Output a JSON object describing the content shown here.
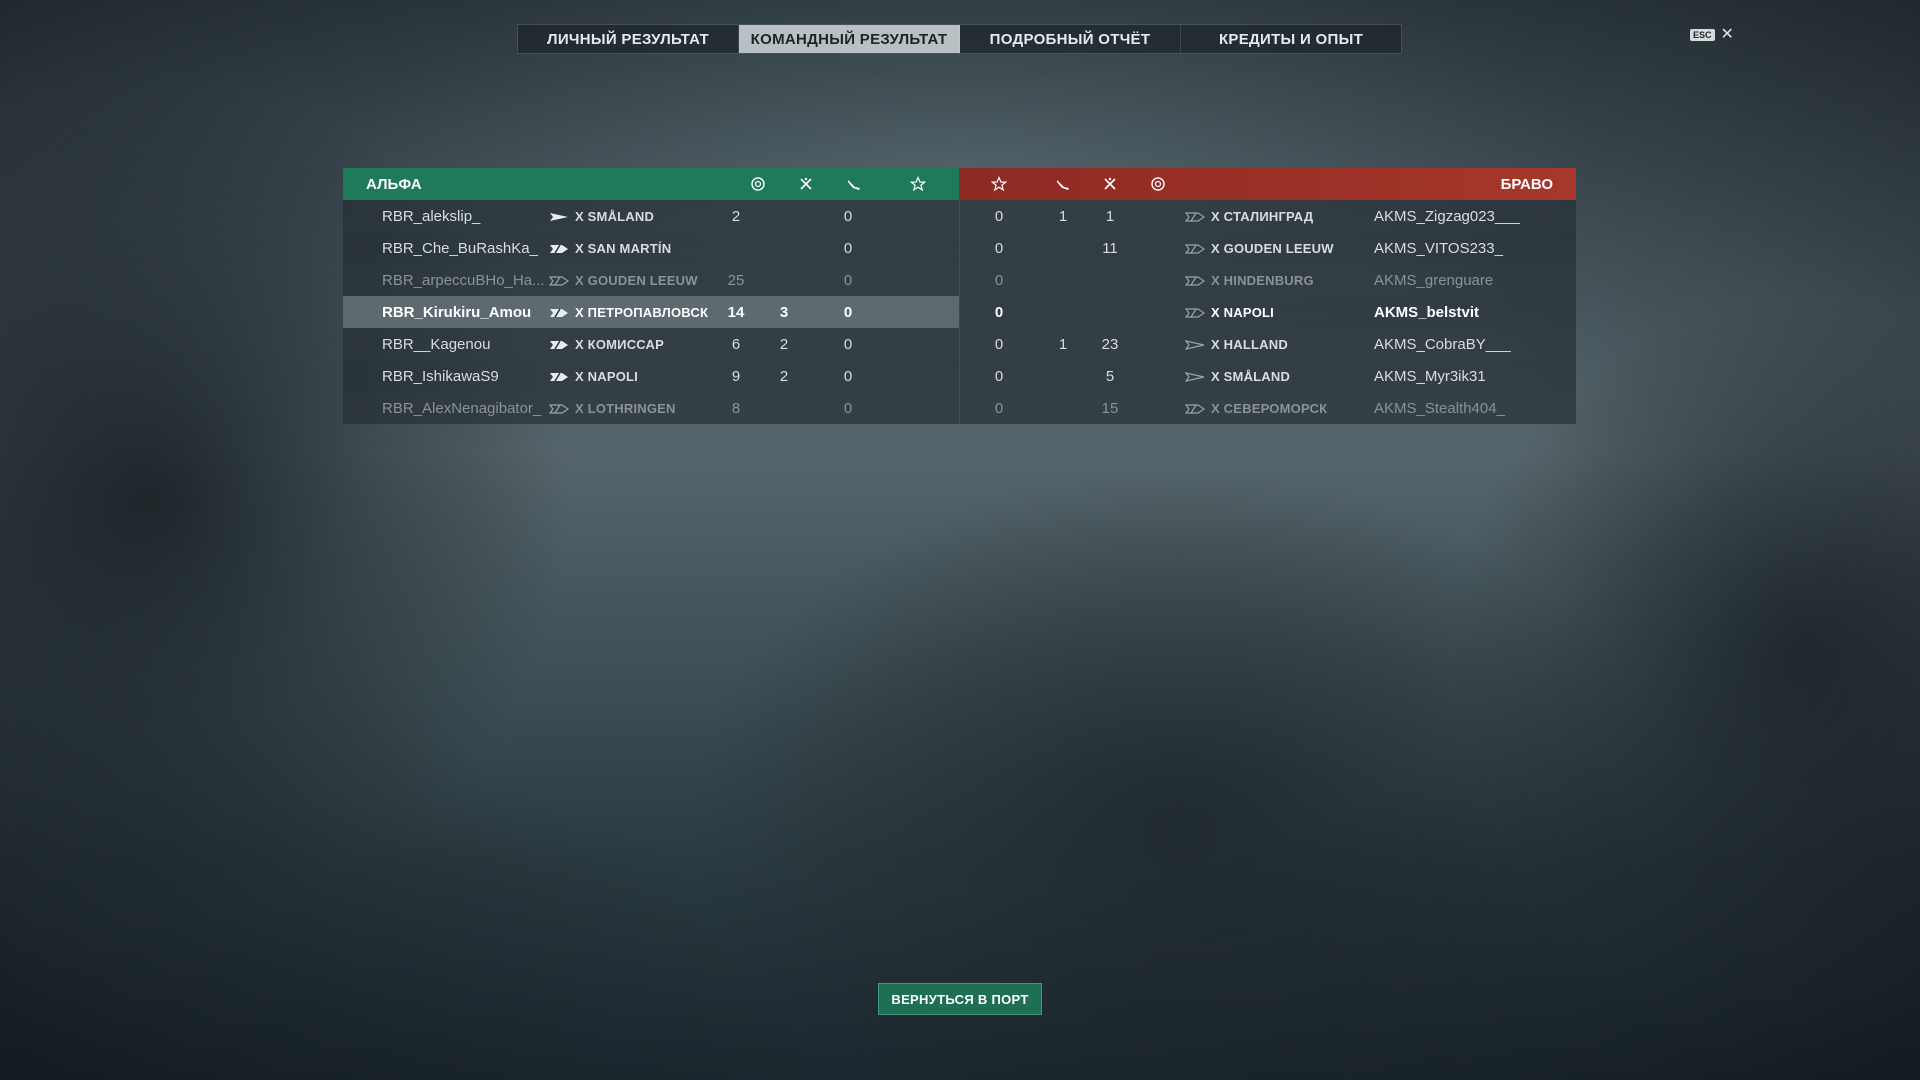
{
  "tabs": [
    {
      "label": "ЛИЧНЫЙ РЕЗУЛЬТАТ",
      "active": false
    },
    {
      "label": "КОМАНДНЫЙ РЕЗУЛЬТАТ",
      "active": true
    },
    {
      "label": "ПОДРОБНЫЙ ОТЧЁТ",
      "active": false
    },
    {
      "label": "КРЕДИТЫ И ОПЫТ",
      "active": false
    }
  ],
  "close": {
    "key_label": "ESC",
    "icon": "close-icon"
  },
  "teams": {
    "alpha": {
      "name": "АЛЬФА",
      "color": "#1e7a59"
    },
    "bravo": {
      "name": "БРАВО",
      "color": "#a8372b"
    }
  },
  "columns": {
    "icons": [
      "base-capture-icon",
      "frags-icon",
      "planes-icon",
      "star-icon"
    ]
  },
  "rows": [
    {
      "state": "alive",
      "left": {
        "player": "RBR_alekslip_",
        "ship": "X SMÅLAND",
        "ship_class": "destroyer",
        "base": "",
        "frags": "2",
        "planes": "",
        "star": "0"
      },
      "right": {
        "player": "AKMS_Zigzag023___",
        "ship": "X СТАЛИНГРАД",
        "ship_class": "cruiser-dead",
        "star": "0",
        "planes": "1",
        "frags": "1",
        "base": ""
      }
    },
    {
      "state": "alive",
      "left": {
        "player": "RBR_Che_BuRashKa_",
        "ship": "X SAN MARTÍN",
        "ship_class": "cruiser",
        "base": "",
        "frags": "",
        "planes": "",
        "star": "0"
      },
      "right": {
        "player": "AKMS_VITOS233_",
        "ship": "X GOUDEN LEEUW",
        "ship_class": "cruiser-dead",
        "star": "0",
        "planes": "",
        "frags": "11",
        "base": ""
      }
    },
    {
      "state": "dead",
      "left": {
        "player": "RBR_arpeccuBHo_Ha...",
        "ship": "X GOUDEN LEEUW",
        "ship_class": "cruiser-dead",
        "base": "",
        "frags": "25",
        "planes": "",
        "star": "0"
      },
      "right": {
        "player": "AKMS_grenguare",
        "ship": "X HINDENBURG",
        "ship_class": "cruiser-dead",
        "star": "0",
        "planes": "",
        "frags": "",
        "base": ""
      }
    },
    {
      "state": "self",
      "left": {
        "player": "RBR_Kirukiru_Amou",
        "ship": "X ПЕТРОПАВЛОВСК",
        "ship_class": "cruiser",
        "base": "",
        "frags": "14",
        "planes": "3",
        "star": "0"
      },
      "right": {
        "player": "AKMS_belstvit",
        "ship": "X NAPOLI",
        "ship_class": "cruiser-dead",
        "star": "0",
        "planes": "",
        "frags": "",
        "base": ""
      }
    },
    {
      "state": "alive",
      "left": {
        "player": "RBR__Kagenou",
        "ship": "X КОМИССАР",
        "ship_class": "cruiser",
        "base": "",
        "frags": "6",
        "planes": "2",
        "star": "0"
      },
      "right": {
        "player": "AKMS_CobraBY___",
        "ship": "X HALLAND",
        "ship_class": "destroyer-dead",
        "star": "0",
        "planes": "1",
        "frags": "23",
        "base": ""
      }
    },
    {
      "state": "alive",
      "left": {
        "player": "RBR_IshikawaS9",
        "ship": "X NAPOLI",
        "ship_class": "cruiser",
        "base": "",
        "frags": "9",
        "planes": "2",
        "star": "0"
      },
      "right": {
        "player": "AKMS_Myr3ik31",
        "ship": "X SMÅLAND",
        "ship_class": "destroyer-dead",
        "star": "0",
        "planes": "",
        "frags": "5",
        "base": ""
      }
    },
    {
      "state": "dead",
      "left": {
        "player": "RBR_AlexNenagibator_",
        "ship": "X LOTHRINGEN",
        "ship_class": "cruiser-dead",
        "base": "",
        "frags": "8",
        "planes": "",
        "star": "0"
      },
      "right": {
        "player": "AKMS_Stealth404_",
        "ship": "X СЕВЕРОМОРСК",
        "ship_class": "cruiser-dead",
        "star": "0",
        "planes": "",
        "frags": "15",
        "base": ""
      }
    }
  ],
  "footer": {
    "back_label": "ВЕРНУТЬСЯ В ПОРТ"
  }
}
